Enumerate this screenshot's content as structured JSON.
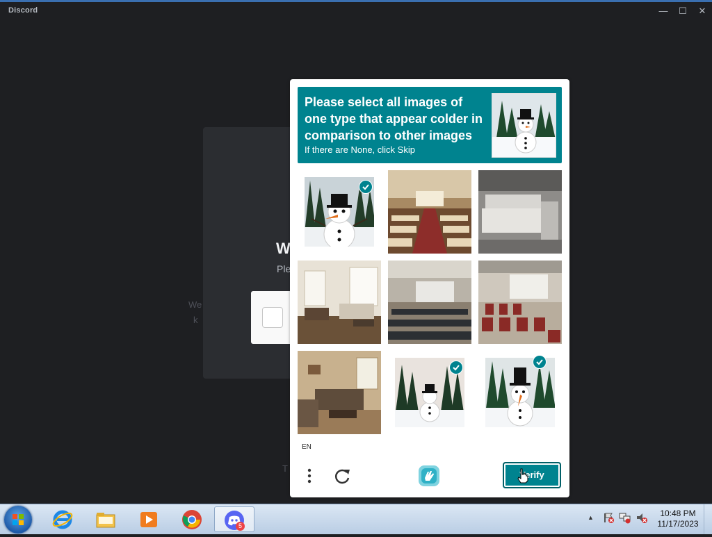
{
  "window": {
    "app_title": "Discord",
    "minimize": "—",
    "maximize": "☐",
    "close": "✕"
  },
  "background_card": {
    "heading": "W",
    "subtitle": "Ple",
    "left_text_1": "We",
    "left_text_2": "k",
    "bottom_text": "T"
  },
  "captcha": {
    "prompt_title": "Please select all images of one type that appear colder in comparison to other images",
    "prompt_subtitle": "If there are None, click Skip",
    "tiles": [
      {
        "subject": "snowman-in-forest",
        "selected": true
      },
      {
        "subject": "conference-hall",
        "selected": false
      },
      {
        "subject": "living-room-sofa",
        "selected": false
      },
      {
        "subject": "living-room",
        "selected": false
      },
      {
        "subject": "seminar-room",
        "selected": false
      },
      {
        "subject": "conference-room",
        "selected": false
      },
      {
        "subject": "living-room",
        "selected": false
      },
      {
        "subject": "snowman-in-forest",
        "selected": true
      },
      {
        "subject": "snowman-in-forest",
        "selected": true
      }
    ],
    "language": "EN",
    "verify_label": "Verify",
    "colors": {
      "accent": "#00838f",
      "verify_border": "#005f67"
    }
  },
  "taskbar": {
    "apps": [
      "start-orb",
      "internet-explorer-icon",
      "file-explorer-icon",
      "media-player-icon",
      "chrome-icon",
      "discord-icon"
    ],
    "discord_badge": "5",
    "clock_time": "10:48 PM",
    "clock_date": "11/17/2023"
  }
}
